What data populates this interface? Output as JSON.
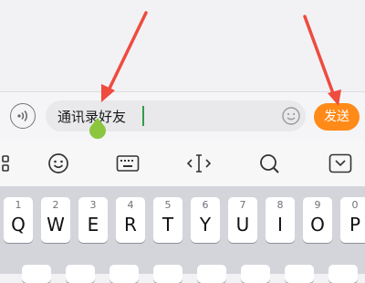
{
  "input": {
    "value": "通讯录好友",
    "voice_icon": "voice-input-icon",
    "emoji_icon": "emoji-smile-icon"
  },
  "send_button": {
    "label": "发送"
  },
  "toolbar": {
    "icons": [
      "grid-apps-icon",
      "emoji-face-icon",
      "keyboard-icon",
      "cursor-move-icon",
      "search-icon",
      "collapse-keyboard-icon"
    ]
  },
  "keyboard": {
    "row1": [
      {
        "letter": "Q",
        "digit": "1"
      },
      {
        "letter": "W",
        "digit": "2"
      },
      {
        "letter": "E",
        "digit": "3"
      },
      {
        "letter": "R",
        "digit": "4"
      },
      {
        "letter": "T",
        "digit": "5"
      },
      {
        "letter": "Y",
        "digit": "6"
      },
      {
        "letter": "U",
        "digit": "7"
      },
      {
        "letter": "I",
        "digit": "8"
      },
      {
        "letter": "O",
        "digit": "9"
      },
      {
        "letter": "P",
        "digit": "0"
      }
    ]
  },
  "annotations": {
    "arrow_color": "#ef4b3f",
    "arrow_targets": [
      "text-input",
      "send-button"
    ]
  },
  "colors": {
    "send_button": "#ff8a18",
    "caret": "#2f9e44",
    "annotation_arrow": "#ef4b3f"
  }
}
